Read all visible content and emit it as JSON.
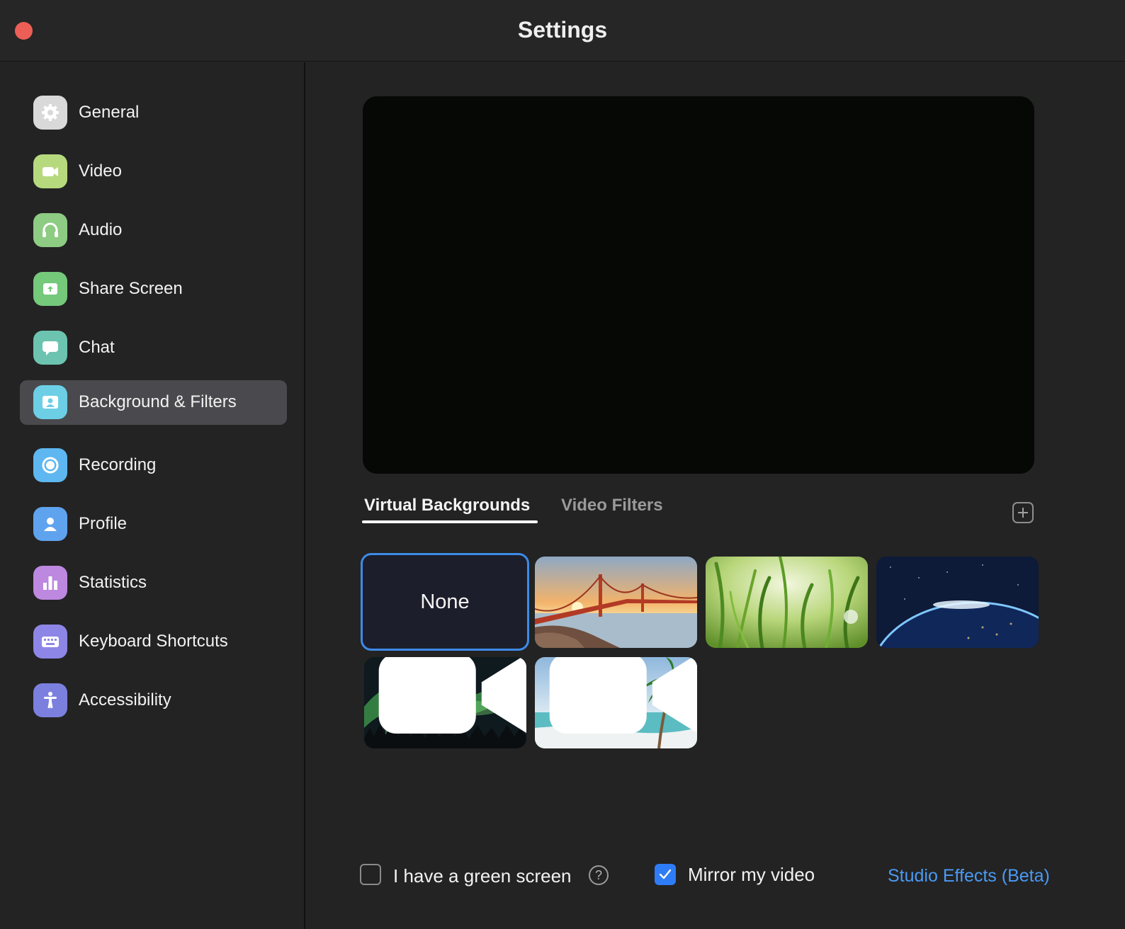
{
  "window": {
    "title": "Settings",
    "close_button": "close"
  },
  "sidebar": {
    "items": [
      {
        "label": "General",
        "icon": "gear-icon",
        "color": "#d9d9d9"
      },
      {
        "label": "Video",
        "icon": "video-camera-icon",
        "color": "#b6d97e"
      },
      {
        "label": "Audio",
        "icon": "headphones-icon",
        "color": "#8ecb83"
      },
      {
        "label": "Share Screen",
        "icon": "share-screen-icon",
        "color": "#74c97a"
      },
      {
        "label": "Chat",
        "icon": "chat-bubble-icon",
        "color": "#6cc3b0"
      },
      {
        "label": "Background & Filters",
        "icon": "background-person-icon",
        "color": "#6ccfe6",
        "active": true
      },
      {
        "label": "Recording",
        "icon": "record-icon",
        "color": "#5eb7f0"
      },
      {
        "label": "Profile",
        "icon": "profile-icon",
        "color": "#5fa3ef"
      },
      {
        "label": "Statistics",
        "icon": "bar-chart-icon",
        "color": "#bd88e0"
      },
      {
        "label": "Keyboard Shortcuts",
        "icon": "keyboard-icon",
        "color": "#8e86e6"
      },
      {
        "label": "Accessibility",
        "icon": "accessibility-icon",
        "color": "#7b80df"
      }
    ]
  },
  "main": {
    "tabs": [
      {
        "label": "Virtual Backgrounds",
        "selected": true
      },
      {
        "label": "Video Filters",
        "selected": false
      }
    ],
    "add_button_icon": "plus-icon",
    "backgrounds": [
      {
        "label": "None",
        "selected": true
      },
      {
        "name": "golden-gate-bridge",
        "video": false
      },
      {
        "name": "grass",
        "video": false
      },
      {
        "name": "earth-from-space",
        "video": false
      },
      {
        "name": "aurora",
        "video": true
      },
      {
        "name": "beach",
        "video": true
      }
    ],
    "footer": {
      "green_screen_label": "I have a green screen",
      "green_screen_checked": false,
      "help_glyph": "?",
      "mirror_label": "Mirror my video",
      "mirror_checked": true,
      "studio_effects_label": "Studio Effects (Beta)"
    },
    "accent_color": "#2e7cf6",
    "link_color": "#4a9af4"
  }
}
